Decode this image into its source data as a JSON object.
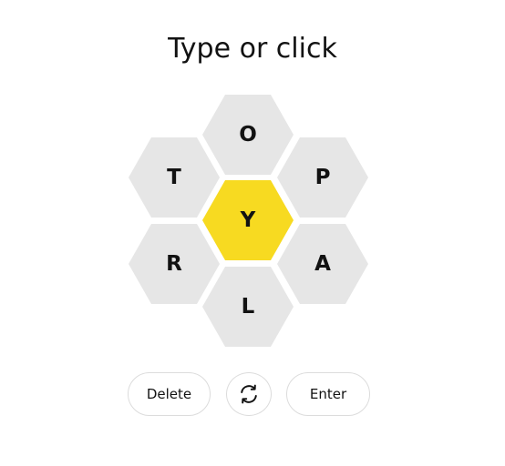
{
  "prompt": "Type or click",
  "letters": {
    "top": "O",
    "upper_left": "T",
    "upper_right": "P",
    "center": "Y",
    "lower_left": "R",
    "lower_right": "A",
    "bottom": "L"
  },
  "buttons": {
    "delete_label": "Delete",
    "enter_label": "Enter",
    "shuffle_icon": "shuffle-icon"
  },
  "colors": {
    "center_cell": "#f7da21",
    "outer_cell": "#e6e6e6",
    "text": "#121212",
    "button_border": "#dcdcdc"
  }
}
